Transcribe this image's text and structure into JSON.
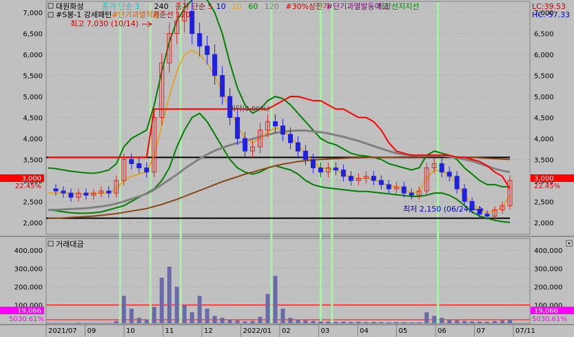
{
  "stock_name": "대원화성",
  "top_legend": [
    {
      "text": "종가 단순 3",
      "color": "#00c8c8"
    },
    {
      "text": "7",
      "color": "#c8c8c8"
    },
    {
      "text": "240",
      "color": "#000000"
    },
    {
      "text": "종가 단순 5",
      "color": "#cc0000"
    },
    {
      "text": "10",
      "color": "#0000cc"
    },
    {
      "text": "20",
      "color": "#e8a000"
    },
    {
      "text": "60",
      "color": "#008000"
    },
    {
      "text": "120",
      "color": "#808080"
    },
    {
      "text": "#30%상한가",
      "color": "#cc0000"
    },
    {
      "text": "#단기과열발동예고",
      "color": "#800080"
    },
    {
      "text": "저항선",
      "color": "#008000"
    },
    {
      "text": "지지선",
      "color": "#008000"
    }
  ],
  "second_legend": [
    {
      "text": "#S봉-1 강세패턴",
      "color": "#000000"
    },
    {
      "text": "#단기과열적출",
      "color": "#e06000"
    },
    {
      "text": "기준선 120",
      "color": "#cc0000"
    }
  ],
  "annotations": {
    "high_label": "최고 7,030 (10/14)",
    "low_label": "최저 2,150 (06/24)",
    "mid_label": "바닥(0.00%)"
  },
  "right_info": {
    "lc": "LC:39.53",
    "hc": "HC:-57.33",
    "price_tag": "3,000",
    "pct_tag": "22.45%",
    "volume_tag": "19,066",
    "volume_pct_tag": "5030.61%"
  },
  "volume_title": "거래대금",
  "colors": {
    "background": "#c0c0c0",
    "up_candle": "#e02020",
    "down_candle": "#2020e0",
    "resistance": "#ff0000",
    "bollinger": "#008000",
    "ma20": "#e8a000",
    "ma120": "#808080",
    "ma240": "#8b4513",
    "signal_band": "#aaf0aa",
    "volume_bar": "#6a6aa8"
  },
  "chart_data": {
    "type": "candlestick",
    "x_tick_labels": [
      "2021/07",
      "09",
      "10",
      "11",
      "12",
      "2022/01",
      "02",
      "03",
      "04",
      "05",
      "06",
      "07",
      "07/11"
    ],
    "price_axis": {
      "ticks": [
        2000,
        2500,
        3000,
        3500,
        4000,
        4500,
        5000,
        5500,
        6000,
        6500,
        7000
      ],
      "tick_labels": [
        "2,000",
        "2,500",
        "3,000",
        "3,500",
        "4,000",
        "4,500",
        "5,000",
        "5,500",
        "6,000",
        "6,500",
        "7,000"
      ],
      "ylim": [
        1750,
        7200
      ]
    },
    "volume_axis": {
      "ticks": [
        100000,
        200000,
        300000,
        400000
      ],
      "tick_labels": [
        "100,000",
        "200,000",
        "300,000",
        "400,000"
      ],
      "ylim": [
        0,
        450000
      ]
    },
    "horizontal_lines": [
      3550,
      2100
    ],
    "price_path": [
      2800,
      2750,
      2700,
      2600,
      2700,
      2650,
      2700,
      2750,
      2700,
      3000,
      3500,
      3400,
      3300,
      3200,
      4500,
      5800,
      6500,
      6800,
      7030,
      6500,
      6200,
      6000,
      5500,
      5000,
      4500,
      4000,
      3700,
      3800,
      4200,
      4400,
      4300,
      4100,
      3900,
      3700,
      3500,
      3300,
      3200,
      3300,
      3250,
      3100,
      3000,
      3050,
      3100,
      3000,
      2900,
      2800,
      2850,
      2700,
      2650,
      2750,
      3300,
      3400,
      3200,
      3100,
      2800,
      2500,
      2300,
      2200,
      2150,
      2300,
      2400,
      3000
    ],
    "resistance_path": [
      3550,
      3550,
      3550,
      3550,
      3550,
      3550,
      3550,
      3550,
      3550,
      3550,
      3550,
      3550,
      3550,
      3550,
      4700,
      4700,
      4700,
      4700,
      4700,
      4700,
      4700,
      4700,
      4700,
      4700,
      4700,
      4700,
      4700,
      4700,
      4700,
      4700,
      4800,
      4900,
      5000,
      5000,
      4950,
      4900,
      4900,
      4800,
      4700,
      4700,
      4600,
      4500,
      4500,
      4400,
      4200,
      3900,
      3700,
      3650,
      3600,
      3600,
      3600,
      3600,
      3600,
      3600,
      3550,
      3550,
      3500,
      3450,
      3350,
      3200,
      3100,
      2800
    ],
    "ma20_path": [
      2700,
      2700,
      2700,
      2690,
      2680,
      2680,
      2690,
      2700,
      2700,
      2800,
      3000,
      3100,
      3150,
      3200,
      3600,
      4300,
      5000,
      5600,
      6000,
      6100,
      6000,
      5800,
      5500,
      5100,
      4700,
      4300,
      4000,
      3900,
      4000,
      4150,
      4250,
      4200,
      4050,
      3850,
      3650,
      3450,
      3300,
      3280,
      3250,
      3150,
      3060,
      3040,
      3060,
      3030,
      2950,
      2870,
      2850,
      2780,
      2710,
      2730,
      3050,
      3250,
      3220,
      3120,
      2900,
      2650,
      2450,
      2300,
      2230,
      2280,
      2350,
      2650
    ],
    "ma120_path": [
      2300,
      2300,
      2310,
      2320,
      2330,
      2340,
      2360,
      2380,
      2410,
      2450,
      2500,
      2560,
      2620,
      2680,
      2780,
      2900,
      3020,
      3140,
      3280,
      3400,
      3520,
      3620,
      3710,
      3780,
      3840,
      3890,
      3940,
      3990,
      4040,
      4090,
      4130,
      4160,
      4180,
      4190,
      4190,
      4170,
      4150,
      4120,
      4080,
      4040,
      3990,
      3940,
      3880,
      3820,
      3760,
      3700,
      3650,
      3620,
      3600,
      3590,
      3590,
      3590,
      3590,
      3570,
      3540,
      3500,
      3460,
      3400,
      3340,
      3280,
      3230,
      3200
    ],
    "ma240_path": [
      2100,
      2100,
      2110,
      2120,
      2130,
      2140,
      2150,
      2170,
      2190,
      2210,
      2240,
      2270,
      2300,
      2330,
      2380,
      2430,
      2490,
      2550,
      2620,
      2690,
      2760,
      2830,
      2900,
      2970,
      3030,
      3090,
      3150,
      3200,
      3250,
      3300,
      3350,
      3390,
      3420,
      3450,
      3470,
      3490,
      3500,
      3510,
      3520,
      3530,
      3540,
      3540,
      3545,
      3550,
      3550,
      3550,
      3555,
      3560,
      3560,
      3560,
      3565,
      3570,
      3570,
      3565,
      3560,
      3550,
      3550,
      3540,
      3530,
      3520,
      3510,
      3500
    ],
    "bollinger_upper": [
      3300,
      3280,
      3250,
      3220,
      3200,
      3180,
      3170,
      3200,
      3250,
      3400,
      3800,
      4000,
      4100,
      4200,
      4800,
      5600,
      6300,
      6800,
      7100,
      7300,
      7400,
      7300,
      7000,
      6500,
      5800,
      5200,
      4800,
      4600,
      4700,
      4900,
      5000,
      4950,
      4800,
      4600,
      4400,
      4200,
      4000,
      3900,
      3850,
      3750,
      3650,
      3600,
      3580,
      3550,
      3500,
      3400,
      3350,
      3300,
      3250,
      3300,
      3600,
      3700,
      3650,
      3600,
      3500,
      3300,
      3150,
      3000,
      2900,
      2900,
      2850,
      2850
    ],
    "bollinger_lower": [
      2300,
      2280,
      2250,
      2230,
      2220,
      2220,
      2230,
      2250,
      2300,
      2350,
      2400,
      2500,
      2600,
      2700,
      2800,
      3000,
      3300,
      3800,
      4200,
      4500,
      4600,
      4400,
      4100,
      3800,
      3500,
      3300,
      3200,
      3150,
      3200,
      3300,
      3350,
      3300,
      3250,
      3150,
      3000,
      2900,
      2850,
      2820,
      2800,
      2780,
      2760,
      2740,
      2740,
      2720,
      2700,
      2680,
      2660,
      2640,
      2620,
      2620,
      2650,
      2700,
      2700,
      2650,
      2550,
      2400,
      2250,
      2150,
      2100,
      2050,
      2020,
      2000
    ],
    "volume": [
      3000,
      2000,
      2500,
      1500,
      3000,
      2000,
      2500,
      1800,
      2200,
      12000,
      150000,
      80000,
      30000,
      20000,
      90000,
      250000,
      310000,
      200000,
      100000,
      60000,
      150000,
      80000,
      40000,
      30000,
      20000,
      15000,
      10000,
      12000,
      35000,
      160000,
      260000,
      80000,
      30000,
      20000,
      15000,
      12000,
      10000,
      9000,
      8000,
      9000,
      7000,
      8000,
      6000,
      7000,
      6000,
      5000,
      6000,
      5000,
      4000,
      5000,
      60000,
      40000,
      30000,
      20000,
      15000,
      12000,
      10000,
      9000,
      8000,
      12000,
      15000,
      19066
    ]
  }
}
